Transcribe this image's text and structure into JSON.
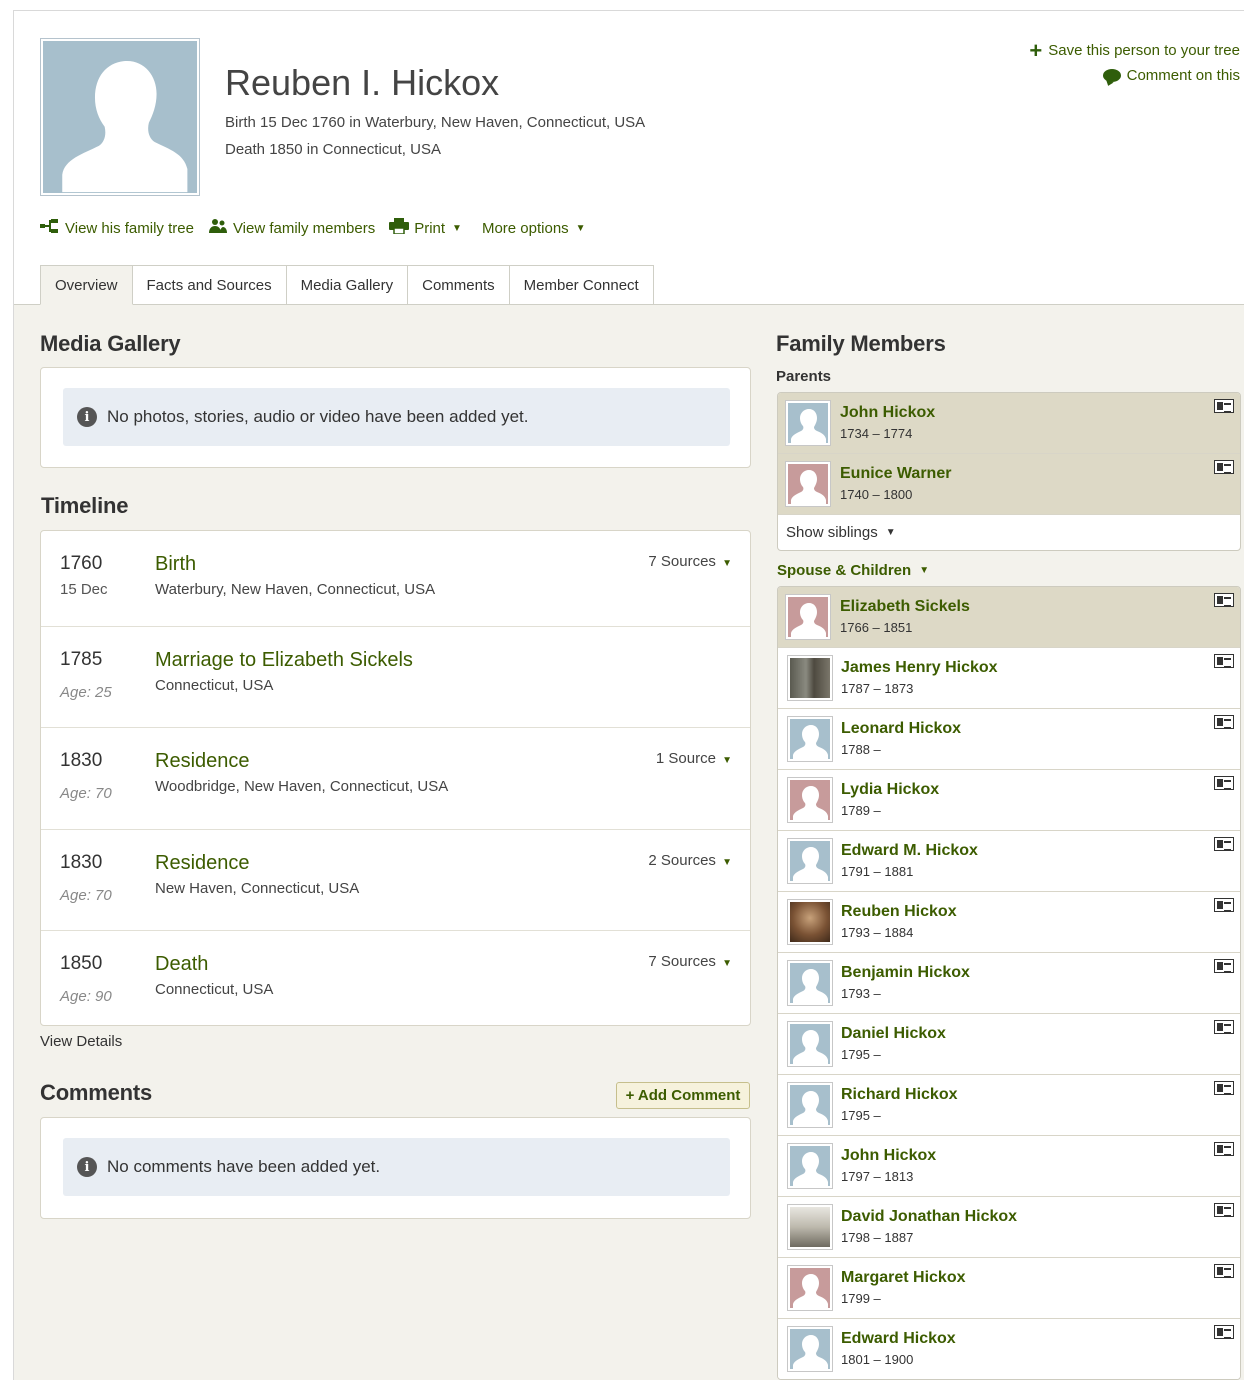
{
  "person": {
    "name": "Reuben I. Hickox",
    "birth": "Birth 15 Dec 1760 in Waterbury, New Haven, Connecticut, USA",
    "death": "Death 1850 in Connecticut, USA"
  },
  "actions": {
    "save": "Save this person to your tree",
    "comment": "Comment on this"
  },
  "toolbar": {
    "family_tree": "View his family tree",
    "family_members": "View family members",
    "print": "Print",
    "more": "More options"
  },
  "tabs": [
    "Overview",
    "Facts and Sources",
    "Media Gallery",
    "Comments",
    "Member Connect"
  ],
  "media": {
    "heading": "Media Gallery",
    "empty": "No photos, stories, audio or video have been added yet."
  },
  "timeline": {
    "heading": "Timeline",
    "events": [
      {
        "year": "1760",
        "sub": "15 Dec",
        "title": "Birth",
        "place": "Waterbury, New Haven, Connecticut, USA",
        "sources": "7 Sources"
      },
      {
        "year": "1785",
        "sub": "Age: 25",
        "title": "Marriage to Elizabeth Sickels",
        "place": "Connecticut, USA",
        "sources": ""
      },
      {
        "year": "1830",
        "sub": "Age: 70",
        "title": "Residence",
        "place": "Woodbridge, New Haven, Connecticut, USA",
        "sources": "1 Source"
      },
      {
        "year": "1830",
        "sub": "Age: 70",
        "title": "Residence",
        "place": "New Haven, Connecticut, USA",
        "sources": "2 Sources"
      },
      {
        "year": "1850",
        "sub": "Age: 90",
        "title": "Death",
        "place": "Connecticut, USA",
        "sources": "7 Sources"
      }
    ],
    "view_details": "View Details"
  },
  "comments": {
    "heading": "Comments",
    "add": "+ Add Comment",
    "empty": "No comments have been added yet."
  },
  "family": {
    "heading": "Family Members",
    "parents_label": "Parents",
    "parents": [
      {
        "name": "John Hickox",
        "dates": "1734 – 1774",
        "thumb": "m"
      },
      {
        "name": "Eunice Warner",
        "dates": "1740 – 1800",
        "thumb": "f"
      }
    ],
    "show_siblings": "Show siblings",
    "spouse_label": "Spouse & Children",
    "spouse": {
      "name": "Elizabeth Sickels",
      "dates": "1766 – 1851",
      "thumb": "f"
    },
    "children": [
      {
        "name": "James Henry Hickox",
        "dates": "1787 – 1873",
        "thumb": "photo1"
      },
      {
        "name": "Leonard Hickox",
        "dates": "1788 –",
        "thumb": "m"
      },
      {
        "name": "Lydia Hickox",
        "dates": "1789 –",
        "thumb": "f"
      },
      {
        "name": "Edward M. Hickox",
        "dates": "1791 – 1881",
        "thumb": "m"
      },
      {
        "name": "Reuben Hickox",
        "dates": "1793 – 1884",
        "thumb": "photo2"
      },
      {
        "name": "Benjamin Hickox",
        "dates": "1793 –",
        "thumb": "m"
      },
      {
        "name": "Daniel Hickox",
        "dates": "1795 –",
        "thumb": "m"
      },
      {
        "name": "Richard Hickox",
        "dates": "1795 –",
        "thumb": "m"
      },
      {
        "name": "John Hickox",
        "dates": "1797 – 1813",
        "thumb": "m"
      },
      {
        "name": "David Jonathan Hickox",
        "dates": "1798 – 1887",
        "thumb": "photo3"
      },
      {
        "name": "Margaret Hickox",
        "dates": "1799 –",
        "thumb": "f"
      },
      {
        "name": "Edward Hickox",
        "dates": "1801 – 1900",
        "thumb": "m"
      }
    ]
  },
  "colors": {
    "link_green": "#3c5c00",
    "tab_bg": "#f3f2ec",
    "highlight_row": "#ddd9c6",
    "info_box": "#e8edf3",
    "male_thumb": "#a7bfcc",
    "female_thumb": "#c79b9b"
  }
}
